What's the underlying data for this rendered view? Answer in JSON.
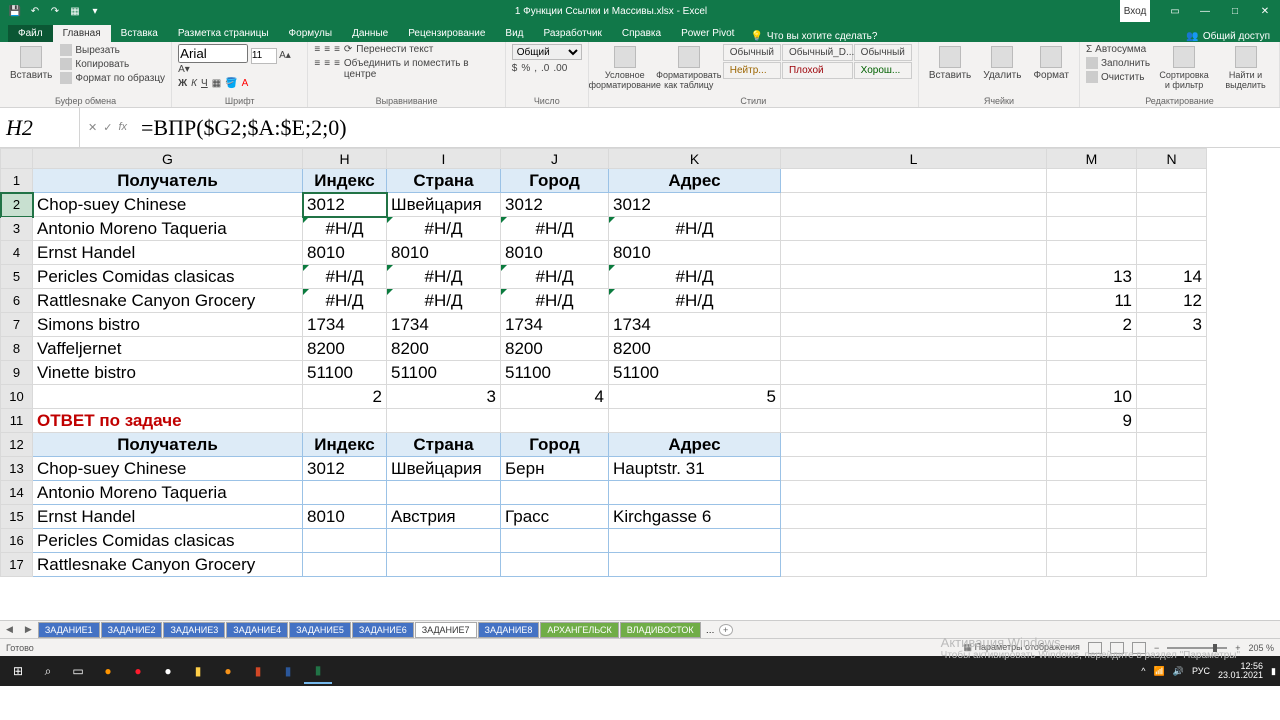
{
  "title": "1 Функции Ссылки и Массивы.xlsx - Excel",
  "login": "Вход",
  "tabs": {
    "file": "Файл",
    "home": "Главная",
    "insert": "Вставка",
    "layout": "Разметка страницы",
    "formulas": "Формулы",
    "data": "Данные",
    "review": "Рецензирование",
    "view": "Вид",
    "dev": "Разработчик",
    "help": "Справка",
    "pivot": "Power Pivot",
    "tell": "Что вы хотите сделать?",
    "share": "Общий доступ"
  },
  "ribbon": {
    "clipboard": {
      "paste": "Вставить",
      "cut": "Вырезать",
      "copy": "Копировать",
      "format": "Формат по образцу",
      "label": "Буфер обмена"
    },
    "font": {
      "name": "Arial",
      "size": "11",
      "label": "Шрифт"
    },
    "align": {
      "wrap": "Перенести текст",
      "merge": "Объединить и поместить в центре",
      "label": "Выравнивание"
    },
    "number": {
      "format": "Общий",
      "label": "Число"
    },
    "styles": {
      "cond": "Условное форматирование",
      "astable": "Форматировать как таблицу",
      "normal": "Обычный",
      "bad": "Плохой",
      "good": "Хорош...",
      "neutral": "Нейтр...",
      "normald": "Обычный_D...",
      "label": "Стили"
    },
    "cells": {
      "insert": "Вставить",
      "delete": "Удалить",
      "format": "Формат",
      "label": "Ячейки"
    },
    "editing": {
      "sum": "Автосумма",
      "fill": "Заполнить",
      "clear": "Очистить",
      "sort": "Сортировка и фильтр",
      "find": "Найти и выделить",
      "label": "Редактирование"
    }
  },
  "namebox": "H2",
  "formula": "=ВПР($G2;$A:$E;2;0)",
  "cols": [
    "G",
    "H",
    "I",
    "J",
    "K",
    "L",
    "M",
    "N"
  ],
  "hdr1": {
    "g": "Получатель",
    "h": "Индекс",
    "i": "Страна",
    "j": "Город",
    "k": "Адрес"
  },
  "rows": [
    {
      "n": "2",
      "g": "Chop-suey Chinese",
      "h": "3012",
      "i": "Швейцария",
      "j": "3012",
      "k": "3012"
    },
    {
      "n": "3",
      "g": "Antonio Moreno Taqueria",
      "h": "#Н/Д",
      "i": "#Н/Д",
      "j": "#Н/Д",
      "k": "#Н/Д",
      "err": true
    },
    {
      "n": "4",
      "g": "Ernst Handel",
      "h": "8010",
      "i": "8010",
      "j": "8010",
      "k": "8010"
    },
    {
      "n": "5",
      "g": "Pericles Comidas clasicas",
      "h": "#Н/Д",
      "i": "#Н/Д",
      "j": "#Н/Д",
      "k": "#Н/Д",
      "err": true,
      "m": "13",
      "nn": "14"
    },
    {
      "n": "6",
      "g": "Rattlesnake Canyon Grocery",
      "h": "#Н/Д",
      "i": "#Н/Д",
      "j": "#Н/Д",
      "k": "#Н/Д",
      "err": true,
      "m": "11",
      "nn": "12"
    },
    {
      "n": "7",
      "g": "Simons bistro",
      "h": "1734",
      "i": "1734",
      "j": "1734",
      "k": "1734",
      "m": "2",
      "nn": "3"
    },
    {
      "n": "8",
      "g": "Vaffeljernet",
      "h": "8200",
      "i": "8200",
      "j": "8200",
      "k": "8200"
    },
    {
      "n": "9",
      "g": "Vinette bistro",
      "h": "51100",
      "i": "51100",
      "j": "51100",
      "k": "51100"
    }
  ],
  "row10": {
    "n": "10",
    "h": "2",
    "i": "3",
    "j": "4",
    "k": "5",
    "m": "10"
  },
  "row11": {
    "n": "11",
    "g": "ОТВЕТ по задаче",
    "m": "9"
  },
  "hdr2": {
    "n": "12",
    "g": "Получатель",
    "h": "Индекс",
    "i": "Страна",
    "j": "Город",
    "k": "Адрес"
  },
  "rows2": [
    {
      "n": "13",
      "g": "Chop-suey Chinese",
      "h": "3012",
      "i": "Швейцария",
      "j": "Берн",
      "k": "Hauptstr. 31"
    },
    {
      "n": "14",
      "g": "Antonio Moreno Taqueria"
    },
    {
      "n": "15",
      "g": "Ernst Handel",
      "h": "8010",
      "i": "Австрия",
      "j": "Грасс",
      "k": "Kirchgasse 6"
    },
    {
      "n": "16",
      "g": "Pericles Comidas clasicas"
    },
    {
      "n": "17",
      "g": "Rattlesnake Canyon Grocery"
    }
  ],
  "sheets": [
    "ЗАДАНИЕ1",
    "ЗАДАНИЕ2",
    "ЗАДАНИЕ3",
    "ЗАДАНИЕ4",
    "ЗАДАНИЕ5",
    "ЗАДАНИЕ6",
    "ЗАДАНИЕ7",
    "ЗАДАНИЕ8",
    "АРХАНГЕЛЬСК",
    "ВЛАДИВОСТОК"
  ],
  "activeSheet": 6,
  "status": {
    "ready": "Готово",
    "params": "Параметры отображения",
    "zoom": "205 %"
  },
  "watermark": {
    "l1": "Активация Windows",
    "l2": "Чтобы активировать Windows, перейдите в раздел \"Параметры\""
  },
  "tray": {
    "lang": "РУС",
    "time": "12:56",
    "date": "23.01.2021"
  }
}
